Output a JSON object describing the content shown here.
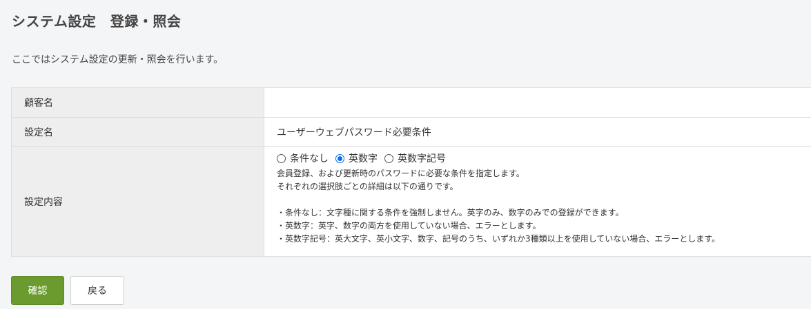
{
  "header": {
    "title": "システム設定　登録・照会",
    "description": "ここではシステム設定の更新・照会を行います。"
  },
  "table": {
    "rows": [
      {
        "label": "顧客名",
        "value": ""
      },
      {
        "label": "設定名",
        "value": "ユーザーウェブパスワード必要条件"
      },
      {
        "label": "設定内容"
      }
    ],
    "options": [
      {
        "label": "条件なし",
        "checked": false
      },
      {
        "label": "英数字",
        "checked": true
      },
      {
        "label": "英数字記号",
        "checked": false
      }
    ],
    "help": [
      "会員登録、および更新時のパスワードに必要な条件を指定します。",
      "それぞれの選択肢ごとの詳細は以下の通りです。"
    ],
    "details": [
      "・条件なし：文字種に関する条件を強制しません。英字のみ、数字のみでの登録ができます。",
      "・英数字：英字、数字の両方を使用していない場合、エラーとします。",
      "・英数字記号：英大文字、英小文字、数字、記号のうち、いずれか3種類以上を使用していない場合、エラーとします。"
    ]
  },
  "buttons": {
    "confirm": "確認",
    "back": "戻る"
  },
  "colors": {
    "confirm_bg": "#6b9a2e",
    "radio_checked": "#0b6fe6",
    "label_bg": "#eeeeee"
  }
}
